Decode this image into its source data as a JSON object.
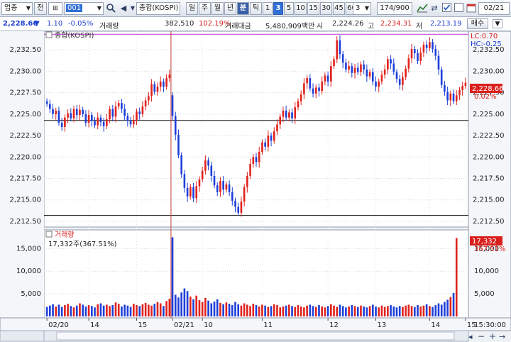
{
  "toolbar": {
    "market_label": "업종",
    "market_mode": "전",
    "code": "001",
    "name": "종합(KOSPI)",
    "periods": [
      "일",
      "주",
      "월",
      "년",
      "분",
      "틱"
    ],
    "active_period": "분",
    "intervals": [
      "1",
      "3",
      "5",
      "10",
      "15",
      "30",
      "45",
      "60"
    ],
    "active_interval": "3",
    "interval_value": "3",
    "count": "174/900",
    "date": "02/21",
    "icons": [
      "search-icon",
      "speaker-icon",
      "chart-tools-icon",
      "checkbox-icon",
      "calendar-icon"
    ]
  },
  "info": {
    "price": "2,228.66",
    "change_arrow": "▼",
    "change": "1.10",
    "change_pct": "-0.05%",
    "volume_label": "거래량",
    "volume": "382,510",
    "volume_ratio": "102.19%",
    "amount_label": "거래대금",
    "amount": "5,480,909백만",
    "open_label": "시",
    "open": "2,224.26",
    "high_label": "고",
    "high": "2,234.31",
    "low_label": "저",
    "low": "2,213.19",
    "trade_button": "매수"
  },
  "price_panel": {
    "title": "종합(KOSPI)",
    "lc_label": "LC:0.70",
    "hc_label": "HC:-0.25",
    "current_label": "2,228.66",
    "current_pct": "0.02%",
    "y_ticks": [
      "2,232.50",
      "2,230.00",
      "2,227.50",
      "2,225.00",
      "2,222.50",
      "2,220.00",
      "2,217.50",
      "2,215.00",
      "2,212.50"
    ]
  },
  "volume_panel": {
    "title": "거래량",
    "value_text": "17,332주(367.51%)",
    "current_label": "17,332",
    "current_pct": "367.51%",
    "y_ticks": [
      "15,000",
      "10,000",
      "5,000"
    ]
  },
  "x_axis": {
    "labels": [
      "02/20",
      "14",
      "15",
      "02/21",
      "10",
      "11",
      "12",
      "13",
      "14",
      "15"
    ],
    "time_label": "15:30:00"
  },
  "chart_data": {
    "type": "candlestick",
    "price_ylim": [
      2212.0,
      2234.5
    ],
    "volume_ylim": [
      0,
      18500
    ],
    "session_break_index": 42,
    "reference_lines": [
      2234.31,
      2224.26,
      2213.19
    ],
    "candles": [
      [
        2226.5,
        2226.2
      ],
      [
        2226.2,
        2225.6
      ],
      [
        2225.6,
        2225.0
      ],
      [
        2225.0,
        2225.4
      ],
      [
        2225.4,
        2224.0
      ],
      [
        2224.0,
        2223.5
      ],
      [
        2223.5,
        2224.6
      ],
      [
        2224.6,
        2225.1
      ],
      [
        2225.1,
        2224.5
      ],
      [
        2224.5,
        2225.6
      ],
      [
        2225.6,
        2224.9
      ],
      [
        2224.9,
        2225.5
      ],
      [
        2225.5,
        2225.0
      ],
      [
        2225.0,
        2224.0
      ],
      [
        2224.0,
        2224.9
      ],
      [
        2224.9,
        2224.2
      ],
      [
        2224.2,
        2223.7
      ],
      [
        2223.7,
        2224.6
      ],
      [
        2224.6,
        2224.1
      ],
      [
        2224.1,
        2223.6
      ],
      [
        2223.6,
        2224.4
      ],
      [
        2224.4,
        2225.6
      ],
      [
        2225.6,
        2224.7
      ],
      [
        2224.7,
        2225.9
      ],
      [
        2225.9,
        2226.3
      ],
      [
        2226.3,
        2225.6
      ],
      [
        2225.6,
        2224.8
      ],
      [
        2224.8,
        2224.2
      ],
      [
        2224.2,
        2223.8
      ],
      [
        2223.8,
        2224.3
      ],
      [
        2224.3,
        2225.3
      ],
      [
        2225.3,
        2225.0
      ],
      [
        2225.0,
        2225.9
      ],
      [
        2225.9,
        2226.6
      ],
      [
        2226.6,
        2227.1
      ],
      [
        2227.1,
        2228.5
      ],
      [
        2228.5,
        2227.6
      ],
      [
        2227.6,
        2228.2
      ],
      [
        2228.2,
        2228.8
      ],
      [
        2228.8,
        2228.2
      ],
      [
        2228.2,
        2229.2
      ],
      [
        2229.2,
        2229.6
      ],
      [
        2227.2,
        2224.8
      ],
      [
        2224.8,
        2222.6
      ],
      [
        2222.6,
        2220.2
      ],
      [
        2220.2,
        2218.0
      ],
      [
        2218.0,
        2216.4
      ],
      [
        2216.4,
        2215.4
      ],
      [
        2215.4,
        2216.5
      ],
      [
        2216.5,
        2215.2
      ],
      [
        2215.2,
        2216.6
      ],
      [
        2216.6,
        2217.4
      ],
      [
        2217.4,
        2218.4
      ],
      [
        2218.4,
        2219.6
      ],
      [
        2219.6,
        2219.0
      ],
      [
        2219.0,
        2217.8
      ],
      [
        2217.8,
        2216.7
      ],
      [
        2216.7,
        2215.9
      ],
      [
        2215.9,
        2217.2
      ],
      [
        2217.2,
        2216.2
      ],
      [
        2216.2,
        2216.8
      ],
      [
        2216.8,
        2215.9
      ],
      [
        2215.9,
        2214.9
      ],
      [
        2214.9,
        2214.2
      ],
      [
        2214.2,
        2213.5
      ],
      [
        2213.5,
        2214.8
      ],
      [
        2214.8,
        2216.5
      ],
      [
        2216.5,
        2217.8
      ],
      [
        2217.8,
        2219.2
      ],
      [
        2219.2,
        2220.0
      ],
      [
        2220.0,
        2219.4
      ],
      [
        2219.4,
        2220.6
      ],
      [
        2220.6,
        2221.7
      ],
      [
        2221.7,
        2221.2
      ],
      [
        2221.2,
        2222.5
      ],
      [
        2222.5,
        2221.9
      ],
      [
        2221.9,
        2223.0
      ],
      [
        2223.0,
        2223.8
      ],
      [
        2223.8,
        2224.7
      ],
      [
        2224.7,
        2225.4
      ],
      [
        2225.4,
        2224.6
      ],
      [
        2224.6,
        2225.2
      ],
      [
        2225.2,
        2224.5
      ],
      [
        2224.5,
        2225.8
      ],
      [
        2225.8,
        2226.5
      ],
      [
        2226.5,
        2227.3
      ],
      [
        2227.3,
        2228.6
      ],
      [
        2228.6,
        2229.2
      ],
      [
        2229.2,
        2228.0
      ],
      [
        2228.0,
        2227.4
      ],
      [
        2227.4,
        2228.1
      ],
      [
        2228.1,
        2227.7
      ],
      [
        2227.7,
        2228.8
      ],
      [
        2228.8,
        2229.5
      ],
      [
        2229.5,
        2228.8
      ],
      [
        2228.8,
        2230.6
      ],
      [
        2230.6,
        2231.4
      ],
      [
        2231.4,
        2233.6
      ],
      [
        2233.6,
        2232.0
      ],
      [
        2232.0,
        2231.0
      ],
      [
        2231.0,
        2230.2
      ],
      [
        2230.2,
        2230.6
      ],
      [
        2230.6,
        2229.8
      ],
      [
        2229.8,
        2230.4
      ],
      [
        2230.4,
        2229.9
      ],
      [
        2229.9,
        2230.8
      ],
      [
        2230.8,
        2230.2
      ],
      [
        2230.2,
        2229.4
      ],
      [
        2229.4,
        2229.9
      ],
      [
        2229.9,
        2228.8
      ],
      [
        2228.8,
        2228.2
      ],
      [
        2228.2,
        2228.8
      ],
      [
        2228.8,
        2229.6
      ],
      [
        2229.6,
        2230.2
      ],
      [
        2230.2,
        2231.4
      ],
      [
        2231.4,
        2230.9
      ],
      [
        2230.9,
        2229.9
      ],
      [
        2229.9,
        2229.1
      ],
      [
        2229.1,
        2228.4
      ],
      [
        2228.4,
        2229.3
      ],
      [
        2229.3,
        2230.3
      ],
      [
        2230.3,
        2231.5
      ],
      [
        2231.5,
        2232.6
      ],
      [
        2232.6,
        2232.1
      ],
      [
        2232.1,
        2231.2
      ],
      [
        2231.2,
        2232.2
      ],
      [
        2232.2,
        2233.1
      ],
      [
        2233.1,
        2232.7
      ],
      [
        2232.7,
        2233.4
      ],
      [
        2233.4,
        2232.6
      ],
      [
        2232.6,
        2231.8
      ],
      [
        2231.8,
        2230.2
      ],
      [
        2230.2,
        2228.4
      ],
      [
        2228.4,
        2227.6
      ],
      [
        2227.6,
        2226.6
      ],
      [
        2226.6,
        2227.4
      ],
      [
        2227.4,
        2226.5
      ],
      [
        2226.5,
        2227.2
      ],
      [
        2227.2,
        2227.8
      ],
      [
        2227.8,
        2228.3
      ],
      [
        2228.3,
        2228.66
      ]
    ],
    "volumes": [
      2100,
      2400,
      2700,
      2200,
      2600,
      2100,
      2500,
      2800,
      2300,
      2000,
      2400,
      2900,
      2600,
      2200,
      2500,
      2300,
      2000,
      2700,
      2900,
      2400,
      2600,
      2300,
      2500,
      3100,
      2800,
      2200,
      2600,
      2400,
      2100,
      2800,
      2500,
      2300,
      2700,
      3000,
      2600,
      2400,
      2800,
      3200,
      2900,
      2300,
      3400,
      3900,
      17500,
      4800,
      4200,
      5300,
      6200,
      5600,
      4400,
      3800,
      4600,
      3600,
      3200,
      4100,
      3500,
      2900,
      3300,
      3800,
      3000,
      2700,
      3100,
      2800,
      2500,
      3200,
      2700,
      2400,
      2900,
      2600,
      2300,
      2800,
      2500,
      2200,
      2600,
      2400,
      2100,
      2300,
      2700,
      2500,
      2000,
      2200,
      2400,
      2600,
      2300,
      2100,
      2500,
      2200,
      2000,
      2400,
      2600,
      2300,
      2100,
      2500,
      2200,
      2000,
      2300,
      2700,
      2400,
      2100,
      2600,
      2300,
      2000,
      2200,
      2500,
      2300,
      2100,
      2400,
      2200,
      2000,
      2300,
      2600,
      2200,
      2000,
      2400,
      2100,
      2300,
      2500,
      2200,
      2000,
      2300,
      2100,
      2400,
      2600,
      2300,
      2100,
      2500,
      2200,
      2400,
      2700,
      2300,
      2100,
      2500,
      2900,
      2600,
      3200,
      3700,
      4300,
      5200,
      17332
    ]
  }
}
